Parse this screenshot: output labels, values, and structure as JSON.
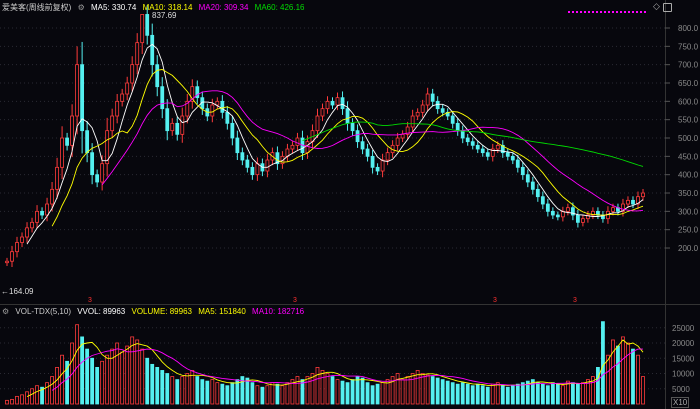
{
  "header": {
    "title": "爱美客(周线前复权)",
    "ma5": "MA5: 330.74",
    "ma10": "MA10: 318.14",
    "ma20": "MA20: 309.34",
    "ma60": "MA60: 426.16"
  },
  "volume_header": {
    "title": "VOL-TDX(5,10)",
    "vvol": "VVOL: 89963",
    "volume": "VOLUME: 89963",
    "ma5": "MA5: 151840",
    "ma10": "MA10: 182716"
  },
  "annotations": {
    "high": "837.69",
    "low": "164.09",
    "unit": "X10",
    "date_marks": [
      "3",
      "3",
      "3",
      "3"
    ]
  },
  "colors": {
    "up": "#ff3b3b",
    "down": "#54f0f0",
    "ma5": "#ffffff",
    "ma10": "#ffff00",
    "ma20": "#ff00ff",
    "ma60": "#00dd00",
    "bg": "#07070d"
  },
  "chart_data": {
    "type": "candlestick",
    "price_ticks": [
      "800.0",
      "750.0",
      "700.0",
      "650.0",
      "600.0",
      "550.0",
      "500.0",
      "450.0",
      "400.0",
      "350.0",
      "300.0",
      "250.0",
      "200.0"
    ],
    "volume_ticks": [
      "25000",
      "20000",
      "15000",
      "10000",
      "5000"
    ],
    "price_range": [
      200,
      800
    ],
    "volume_range": [
      0,
      25000
    ],
    "close": [
      164,
      190,
      215,
      230,
      255,
      270,
      300,
      290,
      320,
      360,
      420,
      500,
      480,
      560,
      700,
      520,
      460,
      400,
      380,
      430,
      520,
      560,
      600,
      620,
      650,
      700,
      760,
      837,
      780,
      700,
      640,
      580,
      520,
      540,
      510,
      560,
      600,
      640,
      610,
      580,
      560,
      590,
      600,
      570,
      540,
      500,
      460,
      440,
      420,
      400,
      430,
      410,
      440,
      460,
      430,
      450,
      470,
      480,
      500,
      460,
      490,
      520,
      560,
      580,
      600,
      590,
      610,
      580,
      540,
      520,
      490,
      470,
      450,
      420,
      410,
      440,
      460,
      480,
      500,
      510,
      530,
      560,
      570,
      590,
      620,
      600,
      580,
      570,
      560,
      540,
      520,
      500,
      490,
      480,
      470,
      460,
      450,
      470,
      480,
      460,
      450,
      440,
      420,
      400,
      380,
      360,
      340,
      320,
      300,
      290,
      285,
      300,
      310,
      290,
      270,
      280,
      290,
      300,
      290,
      280,
      300,
      310,
      300,
      320,
      330,
      320,
      340,
      350
    ],
    "volume": [
      1200,
      1500,
      2500,
      3000,
      4000,
      5000,
      6000,
      5500,
      7000,
      9000,
      12000,
      16000,
      14000,
      20000,
      26000,
      22000,
      18000,
      15000,
      12000,
      14000,
      16000,
      18000,
      20000,
      17000,
      19000,
      22000,
      21000,
      18000,
      15000,
      13000,
      12000,
      11000,
      10000,
      9000,
      8000,
      9000,
      10000,
      11000,
      9000,
      8000,
      7500,
      8000,
      7000,
      6500,
      6000,
      7000,
      8000,
      9000,
      8500,
      7000,
      6000,
      5500,
      6000,
      7000,
      6500,
      6000,
      7000,
      8000,
      9000,
      8000,
      9000,
      10000,
      12000,
      11000,
      10000,
      9000,
      8000,
      7500,
      7000,
      8000,
      9000,
      8500,
      7000,
      6000,
      6500,
      7000,
      8000,
      9000,
      10000,
      8000,
      9000,
      10000,
      11000,
      10000,
      9500,
      9000,
      8500,
      8000,
      7500,
      7000,
      6500,
      7000,
      6500,
      6000,
      6500,
      6000,
      5500,
      6500,
      7000,
      6000,
      5500,
      6000,
      6500,
      7000,
      7500,
      8000,
      7000,
      6500,
      6000,
      7000,
      6500,
      6000,
      7500,
      7000,
      6500,
      7000,
      8000,
      9000,
      12000,
      27000,
      16000,
      21000,
      19000,
      22000,
      20000,
      18000,
      16000,
      8996
    ]
  }
}
